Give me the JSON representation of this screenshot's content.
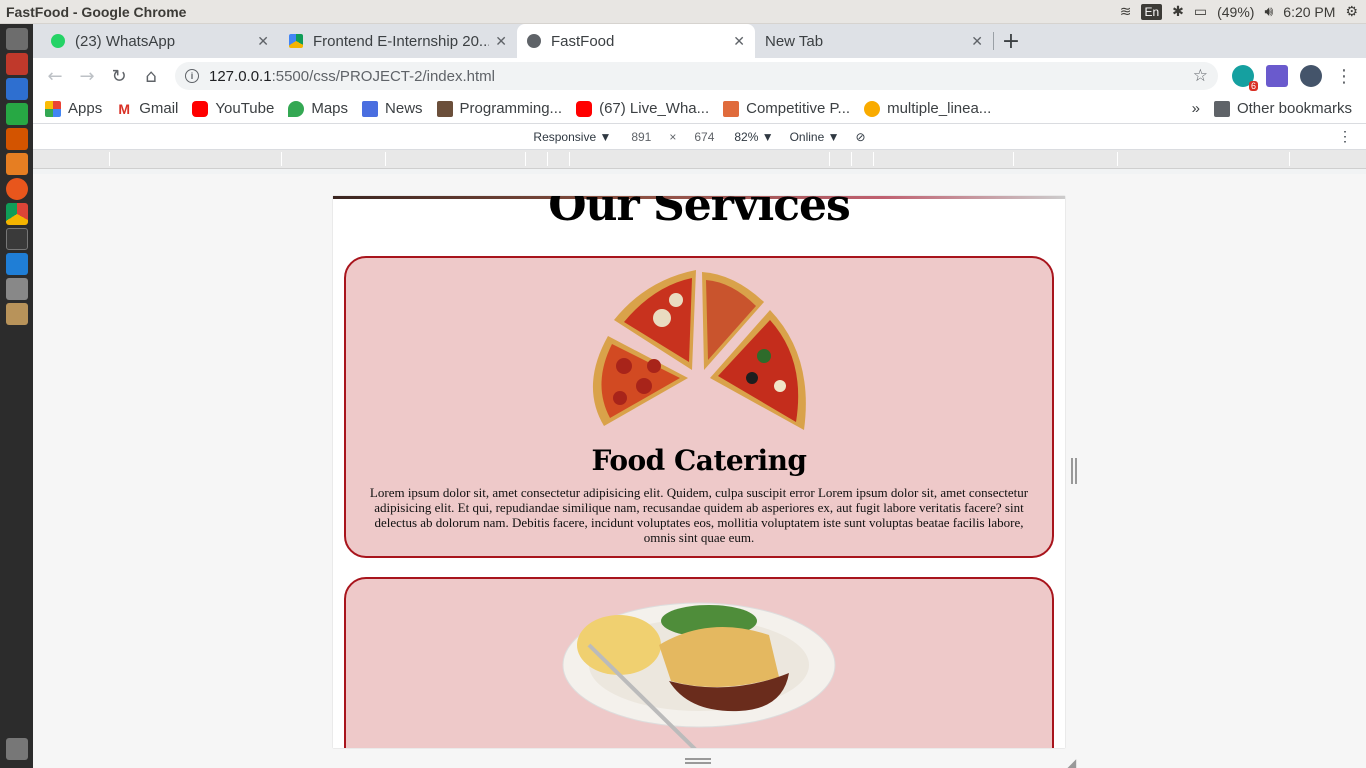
{
  "os": {
    "window_title": "FastFood - Google Chrome",
    "lang": "En",
    "battery": "(49%)",
    "clock": "6:20 PM",
    "launcher_icons": [
      "app-icon",
      "files-icon",
      "writer-icon",
      "calc-icon",
      "impress-icon",
      "software-icon",
      "firefox-icon",
      "chrome-icon",
      "terminal-icon",
      "vscode-icon",
      "settings-icon",
      "archive-icon",
      "trash-icon"
    ]
  },
  "tabs": [
    {
      "title": "(23) WhatsApp",
      "badge": "23"
    },
    {
      "title": "Frontend E-Internship 20..."
    },
    {
      "title": "FastFood"
    },
    {
      "title": "New Tab"
    }
  ],
  "omnibox": {
    "host": "127.0.0.1",
    "path": ":5500/css/PROJECT-2/index.html"
  },
  "extension_badge": "6",
  "bookmarks": {
    "items": [
      "Apps",
      "Gmail",
      "YouTube",
      "Maps",
      "News",
      "Programming...",
      "(67) Live_Wha...",
      "Competitive P...",
      "multiple_linea..."
    ],
    "more": "»",
    "other": "Other bookmarks"
  },
  "devtools": {
    "device": "Responsive ▼",
    "width": "891",
    "times": "×",
    "height": "674",
    "zoom": "82% ▼",
    "network": "Online ▼"
  },
  "page": {
    "heading": "Our Services",
    "cards": [
      {
        "image": "pizza-slices-image",
        "title": "Food Catering",
        "text": "Lorem ipsum dolor sit, amet consectetur adipisicing elit. Quidem, culpa suscipit error Lorem ipsum dolor sit, amet consectetur adipisicing elit. Et qui, repudiandae similique nam, recusandae quidem ab asperiores ex, aut fugit labore veritatis facere? sint delectus ab dolorum nam. Debitis facere, incidunt voluptates eos, mollitia voluptatem iste sunt voluptas beatae facilis labore, omnis sint quae eum."
      },
      {
        "image": "pie-dinner-plate-image"
      }
    ]
  },
  "colors": {
    "card_bg": "#eec9c9",
    "card_border": "#a8141c"
  }
}
